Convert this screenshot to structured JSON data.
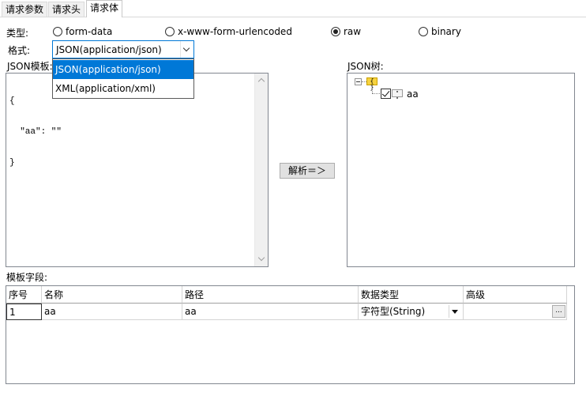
{
  "tabs": [
    {
      "label": "请求参数",
      "active": false
    },
    {
      "label": "请求头",
      "active": false
    },
    {
      "label": "请求体",
      "active": true
    }
  ],
  "type_label": "类型:",
  "body_types": [
    {
      "label": "form-data",
      "checked": false
    },
    {
      "label": "x-www-form-urlencoded",
      "checked": false
    },
    {
      "label": "raw",
      "checked": true
    },
    {
      "label": "binary",
      "checked": false
    }
  ],
  "format_label": "格式:",
  "format": {
    "selected": "JSON(application/json)",
    "options": [
      "JSON(application/json)",
      "XML(application/xml)"
    ]
  },
  "json_template": {
    "label": "JSON模板:",
    "lines": [
      "{",
      "  \"aa\": \"\"",
      "}"
    ]
  },
  "parse_button": "解析＝＞",
  "json_tree": {
    "label": "JSON树:",
    "root_icon": "{ }",
    "node_icon": "\" \"",
    "node_label": "aa",
    "node_checked": true
  },
  "fields": {
    "label": "模板字段:",
    "columns": [
      "序号",
      "名称",
      "路径",
      "数据类型",
      "高级"
    ],
    "rows": [
      {
        "index": "1",
        "name": "aa",
        "path": "aa",
        "type": "字符型(String)",
        "advanced_button": "..."
      }
    ]
  },
  "colors": {
    "accent": "#0078d7",
    "border": "#828790"
  }
}
